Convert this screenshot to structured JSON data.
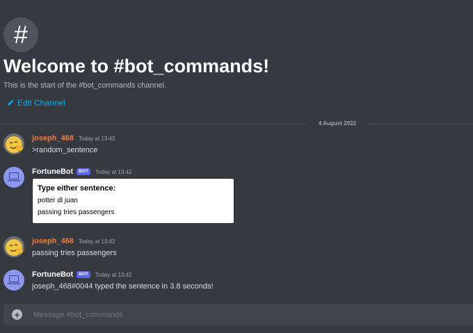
{
  "channel": {
    "icon": "#",
    "icon_name": "hashtag-icon",
    "welcome_title": "Welcome to #bot_commands!",
    "welcome_subtitle": "This is the start of the #bot_commands channel.",
    "edit_label": "Edit Channel"
  },
  "date_divider": "4 August 2022",
  "messages": [
    {
      "author": "joseph_468",
      "author_color": "#f47b3c",
      "timestamp": "Today at 13:42",
      "text": ">random_sentence"
    },
    {
      "author": "FortuneBot",
      "bot_tag": "BOT",
      "timestamp": "Today at 13:42",
      "avatar_text": "Fortunebot",
      "embed": {
        "title": "Type either sentence:",
        "lines": [
          "potter dl juan",
          "passing tries passengers"
        ]
      }
    },
    {
      "author": "joseph_468",
      "author_color": "#f47b3c",
      "timestamp": "Today at 13:42",
      "text": "passing tries passengers"
    },
    {
      "author": "FortuneBot",
      "bot_tag": "BOT",
      "timestamp": "Today at 13:42",
      "avatar_text": "Fortunebot",
      "text": "joseph_468#0044 typed the sentence in 3.8 seconds!"
    }
  ],
  "composer": {
    "placeholder": "Message #bot_commands",
    "value": ""
  },
  "colors": {
    "background": "#36393f",
    "link": "#00aff4",
    "bot_tag": "#5865f2"
  }
}
